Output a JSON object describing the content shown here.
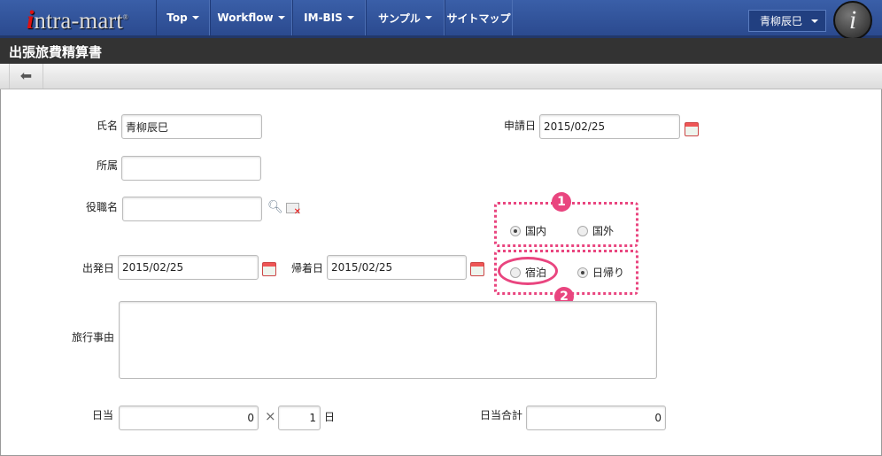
{
  "header": {
    "logo": "intra-mart",
    "nav": [
      "Top",
      "Workflow",
      "IM-BIS",
      "サンプル",
      "サイトマップ"
    ],
    "user": "青柳辰巳"
  },
  "page_title": "出張旅費精算書",
  "form": {
    "name_label": "氏名",
    "name_value": "青柳辰巳",
    "dept_label": "所属",
    "dept_value": "",
    "position_label": "役職名",
    "position_value": "",
    "apply_date_label": "申請日",
    "apply_date_value": "2015/02/25",
    "region": {
      "marker": "1",
      "options": [
        "国内",
        "国外"
      ],
      "selected": "国内"
    },
    "stay": {
      "marker": "2",
      "options": [
        "宿泊",
        "日帰り"
      ],
      "selected": "日帰り"
    },
    "depart_label": "出発日",
    "depart_value": "2015/02/25",
    "return_label": "帰着日",
    "return_value": "2015/02/25",
    "reason_label": "旅行事由",
    "reason_value": "",
    "daily_label": "日当",
    "daily_value": "0",
    "times": "×",
    "days_value": "1",
    "days_unit": "日",
    "daily_total_label": "日当合計",
    "daily_total_value": "0"
  }
}
